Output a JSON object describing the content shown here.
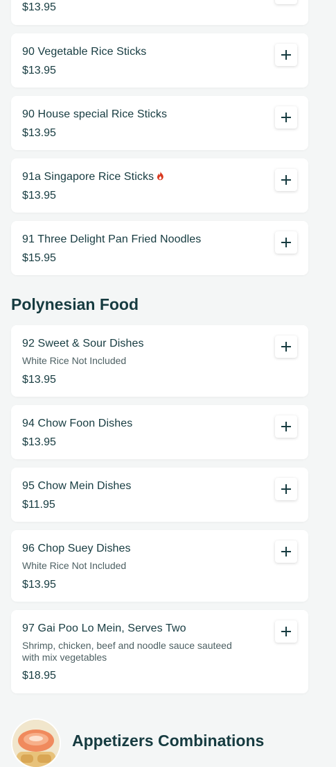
{
  "top_item": {
    "price": "$13.95"
  },
  "items_a": [
    {
      "name": "90 Vegetable Rice Sticks",
      "price": "$13.95"
    },
    {
      "name": "90 House special Rice Sticks",
      "price": "$13.95"
    },
    {
      "name": "91a Singapore Rice Sticks",
      "price": "$13.95",
      "spicy": true
    },
    {
      "name": "91 Three Delight Pan Fried Noodles",
      "price": "$15.95"
    }
  ],
  "section": {
    "title": "Polynesian Food"
  },
  "items_b": [
    {
      "name": "92 Sweet & Sour Dishes",
      "description": "White Rice Not Included",
      "price": "$13.95"
    },
    {
      "name": "94 Chow Foon Dishes",
      "price": "$13.95"
    },
    {
      "name": "95 Chow Mein Dishes",
      "price": "$11.95"
    },
    {
      "name": "96 Chop Suey Dishes",
      "description": "White Rice Not Included",
      "price": "$13.95"
    },
    {
      "name": "97 Gai Poo Lo Mein, Serves Two",
      "description": "Shrimp, chicken, beef and noodle sauce sauteed with mix vegetables",
      "price": "$18.95"
    }
  ],
  "next_section": {
    "title": "Appetizers Combinations"
  },
  "icons": {
    "add": "plus-icon",
    "spicy": "flame-icon"
  },
  "colors": {
    "text": "#163b40",
    "muted": "#4c5f62",
    "background": "#f4f6f6",
    "card": "#ffffff",
    "spicy": "#d9381e"
  }
}
